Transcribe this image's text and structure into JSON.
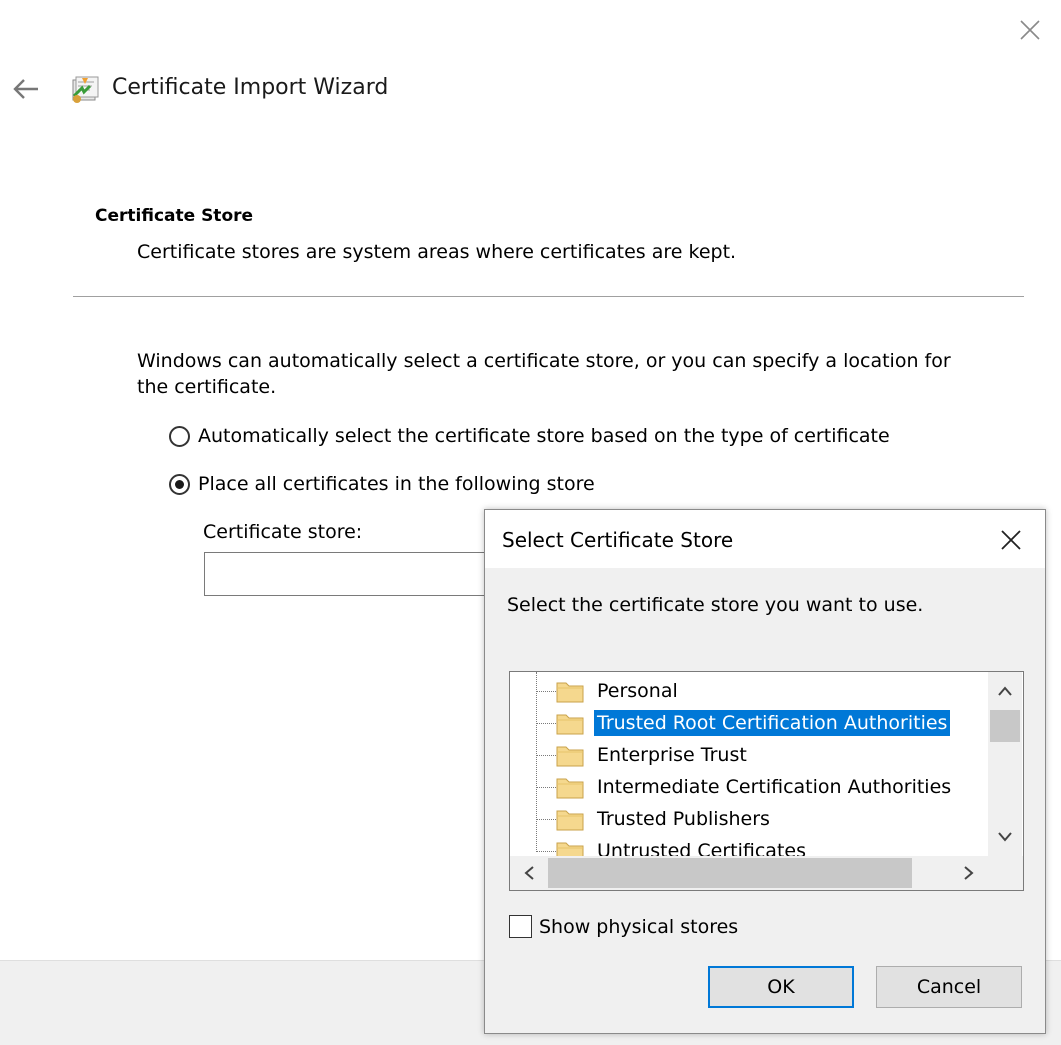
{
  "wizard": {
    "title": "Certificate Import Wizard",
    "section_title": "Certificate Store",
    "section_desc": "Certificate stores are system areas where certificates are kept.",
    "intro": "Windows can automatically select a certificate store, or you can specify a location for the certificate.",
    "radio_auto_label": "Automatically select the certificate store based on the type of certificate",
    "radio_place_label": "Place all certificates in the following store",
    "selected_option": "place",
    "store_label": "Certificate store:",
    "store_value": ""
  },
  "dialog": {
    "title": "Select Certificate Store",
    "prompt": "Select the certificate store you want to use.",
    "stores": [
      "Personal",
      "Trusted Root Certification Authorities",
      "Enterprise Trust",
      "Intermediate Certification Authorities",
      "Trusted Publishers",
      "Untrusted Certificates"
    ],
    "selected_store": "Trusted Root Certification Authorities",
    "show_physical_label": "Show physical stores",
    "show_physical_checked": false,
    "ok_label": "OK",
    "cancel_label": "Cancel"
  },
  "colors": {
    "selection": "#0078d7",
    "folder": "#f5d88e"
  },
  "icons": {
    "back": "arrow-left-icon",
    "close": "close-icon",
    "wizard": "certificate-icon",
    "folder": "folder-icon"
  }
}
